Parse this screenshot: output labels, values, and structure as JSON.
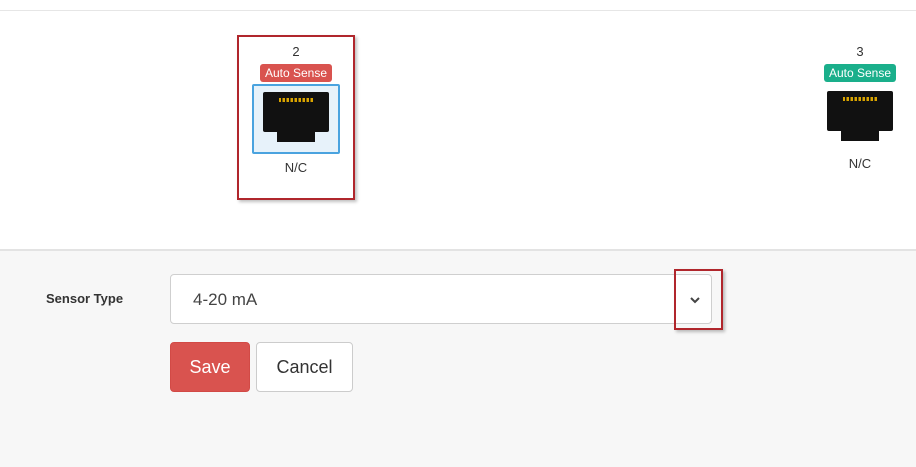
{
  "ports": [
    {
      "number": "2",
      "badge": "Auto Sense",
      "badge_color": "#d9534f",
      "status": "N/C",
      "selected": true,
      "icon": "ethernet-port-icon"
    },
    {
      "number": "3",
      "badge": "Auto Sense",
      "badge_color": "#1aaf8b",
      "status": "N/C",
      "selected": false,
      "icon": "ethernet-port-icon"
    }
  ],
  "form": {
    "sensor_type_label": "Sensor Type",
    "sensor_type_value": "4-20 mA",
    "dropdown_icon": "chevron-down-icon",
    "save_label": "Save",
    "cancel_label": "Cancel"
  },
  "colors": {
    "danger": "#d9534f",
    "success": "#1aaf8b",
    "selection": "#4aa3df",
    "callout": "#b0262c"
  }
}
